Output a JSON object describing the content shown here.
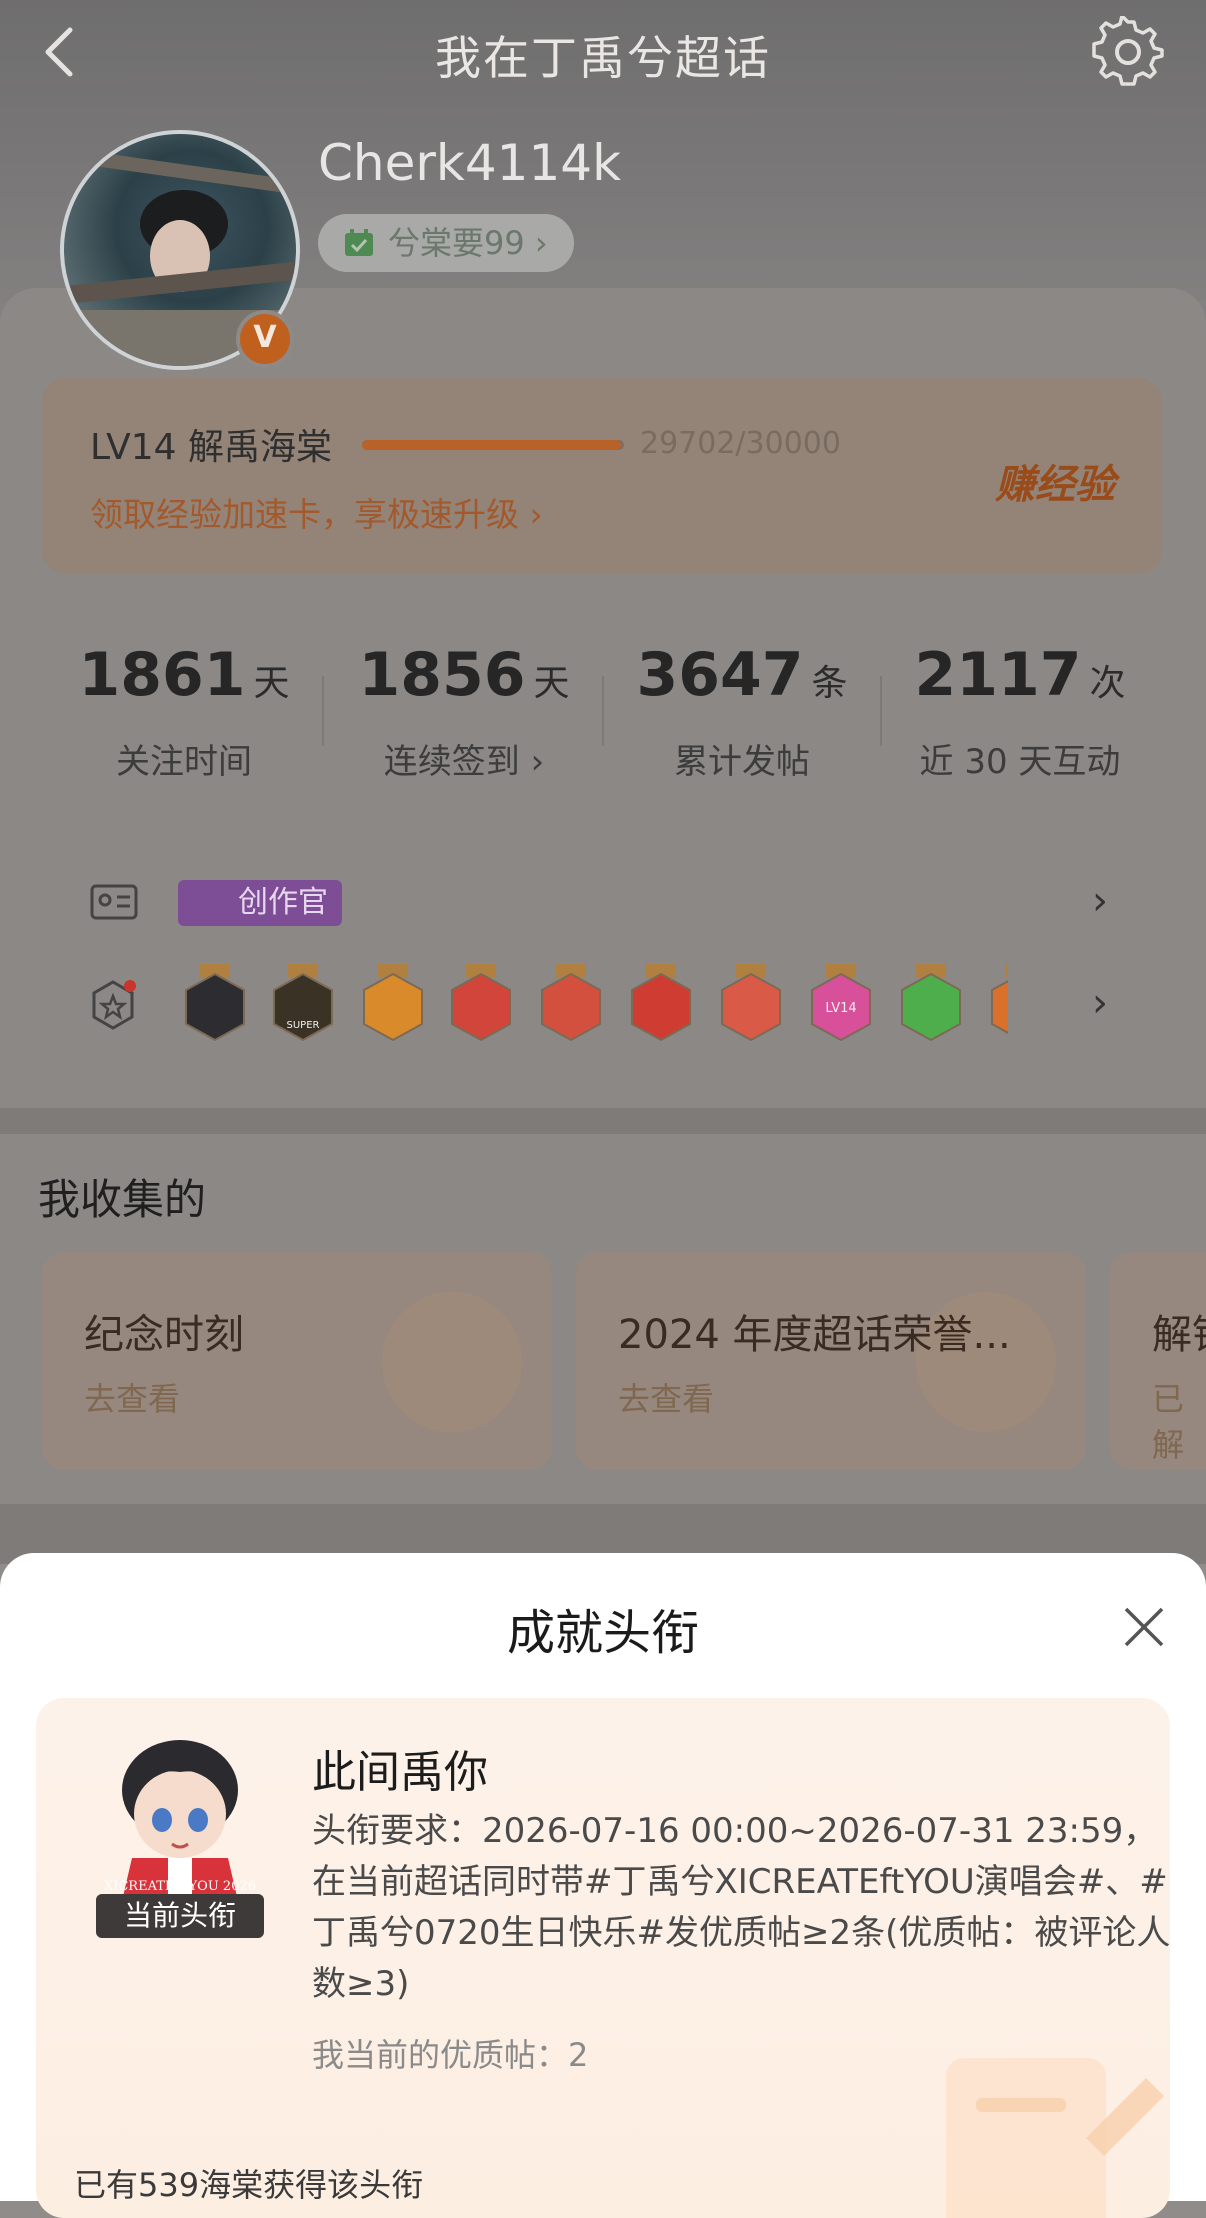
{
  "header": {
    "title": "我在丁禹兮超话",
    "back": "back-icon",
    "settings": "gear-icon"
  },
  "profile": {
    "username": "Cherk4114k",
    "nickname_pill": "兮棠要99 ›",
    "verified_badge": "V"
  },
  "level": {
    "label": "LV14 解禹海棠",
    "progress_text": "29702/30000",
    "progress_value": 0.99,
    "promo": "领取经验加速卡，享极速升级 ›",
    "earn_label": "赚经验"
  },
  "stats": [
    {
      "num": "1861",
      "unit": "天",
      "label": "关注时间"
    },
    {
      "num": "1856",
      "unit": "天",
      "label": "连续签到 ›"
    },
    {
      "num": "3647",
      "unit": "条",
      "label": "累计发帖"
    },
    {
      "num": "2117",
      "unit": "次",
      "label": "近 30 天互动"
    }
  ],
  "badges": {
    "creator": "创作官"
  },
  "medal_strip": {
    "super_text": "SUPER",
    "lv_text": "LV14"
  },
  "collection": {
    "title": "我收集的",
    "cards": [
      {
        "title": "纪念时刻",
        "sub": "去查看"
      },
      {
        "title": "2024 年度超话荣誉...",
        "sub": "去查看"
      },
      {
        "title": "解锁",
        "sub": "已解"
      }
    ]
  },
  "sheet": {
    "title": "成就头衔",
    "achievement": {
      "name": "此间禹你",
      "tag": "当前头衔",
      "chibi_text": "XICREATE ftYOU 2026",
      "requirement": "头衔要求：2026-07-16 00:00~2026-07-31 23:59，在当前超话同时带#丁禹兮XICREATEftYOU演唱会#、#丁禹兮0720生日快乐#发优质帖≥2条(优质帖：被评论人数≥3)",
      "mine": "我当前的优质帖：2",
      "count": "已有539海棠获得该头衔"
    }
  },
  "colors": {
    "accent": "#e07a34",
    "dim_overlay": "#8b8886",
    "sheet_bg": "#ffffff"
  }
}
